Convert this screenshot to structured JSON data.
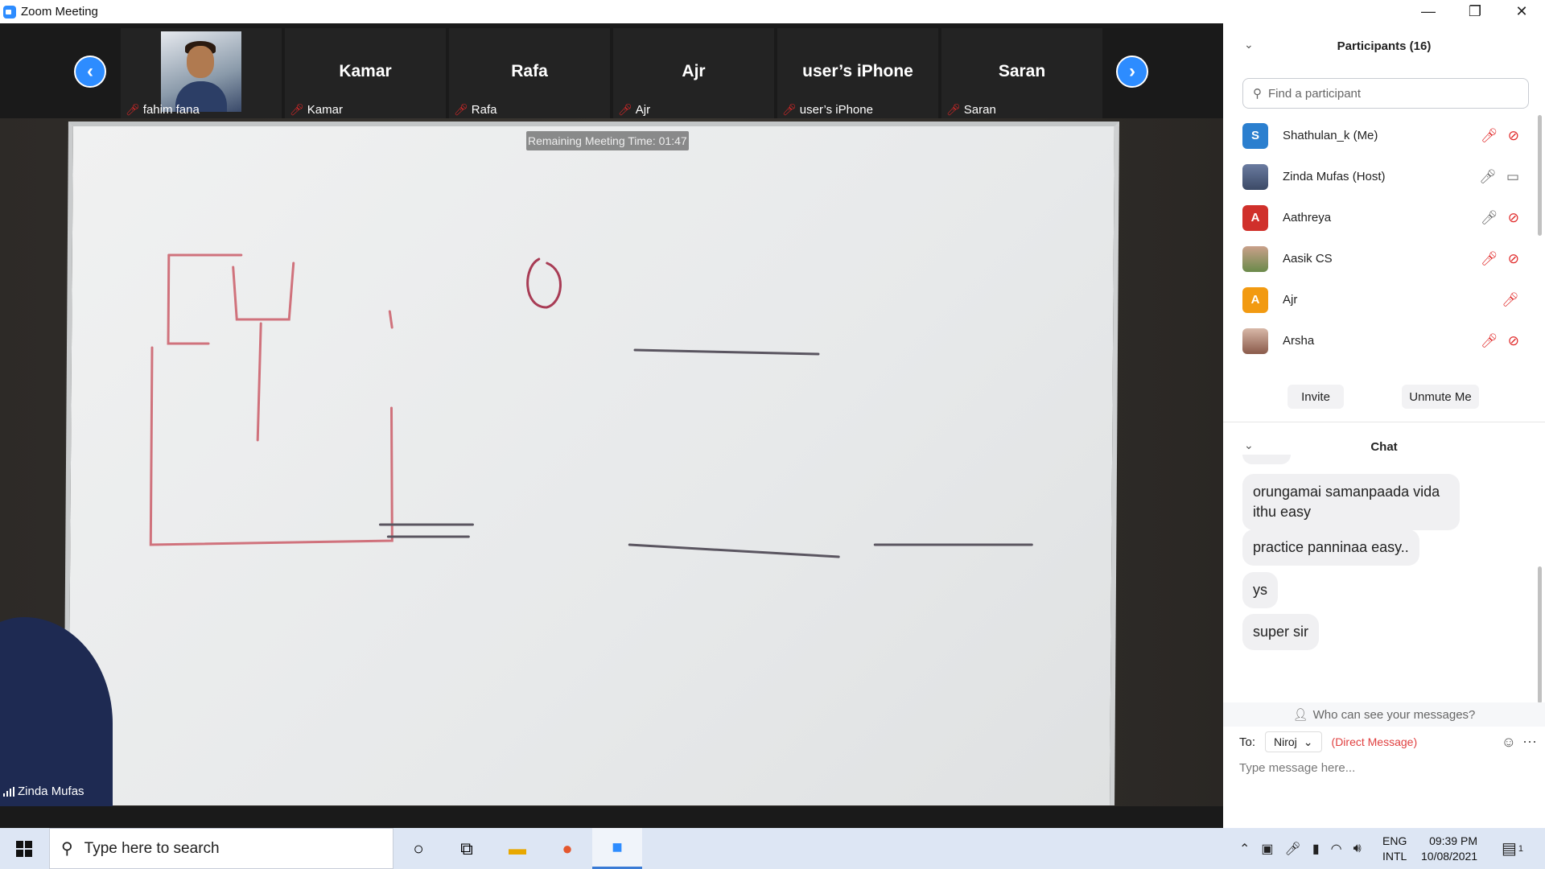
{
  "window": {
    "title": "Zoom Meeting",
    "minimize": "—",
    "restore": "❐",
    "close": "✕"
  },
  "meeting": {
    "remaining_time": "Remaining Meeting Time: 01:47",
    "active_speaker": "Zinda Mufas",
    "nav_prev": "‹",
    "nav_next": "›",
    "tiles": [
      {
        "name": "",
        "label": "fahim fana"
      },
      {
        "name": "Kamar",
        "label": "Kamar"
      },
      {
        "name": "Rafa",
        "label": "Rafa"
      },
      {
        "name": "Ajr",
        "label": "Ajr"
      },
      {
        "name": "user’s iPhone",
        "label": "user’s iPhone"
      },
      {
        "name": "Saran",
        "label": "Saran"
      }
    ]
  },
  "participants": {
    "title": "Participants (16)",
    "search_placeholder": "Find a participant",
    "items": [
      {
        "initial": "S",
        "name": "Shathulan_k (Me)",
        "color": "#2b7fcf"
      },
      {
        "initial": "",
        "name": "Zinda Mufas (Host)",
        "color": "#5b6b8a"
      },
      {
        "initial": "A",
        "name": "Aathreya",
        "color": "#d0302b"
      },
      {
        "initial": "",
        "name": "Aasik CS",
        "color": "#8a6a5a"
      },
      {
        "initial": "A",
        "name": "Ajr",
        "color": "#f29a11"
      },
      {
        "initial": "",
        "name": "Arsha",
        "color": "#9a7a6a"
      }
    ],
    "invite": "Invite",
    "unmute": "Unmute Me"
  },
  "chat": {
    "title": "Chat",
    "messages": [
      "orungamai samanpaada vida ithu easy",
      "practice panninaa easy..",
      "ys",
      "super sir"
    ],
    "who_can_see": "Who can see your messages?",
    "to_label": "To:",
    "recipient": "Niroj",
    "direct_message": "(Direct Message)",
    "input_placeholder": "Type message here..."
  },
  "taskbar": {
    "search_placeholder": "Type here to search",
    "lang_top": "ENG",
    "lang_bottom": "INTL",
    "time": "09:39 PM",
    "date": "10/08/2021",
    "notification_count": "1"
  }
}
